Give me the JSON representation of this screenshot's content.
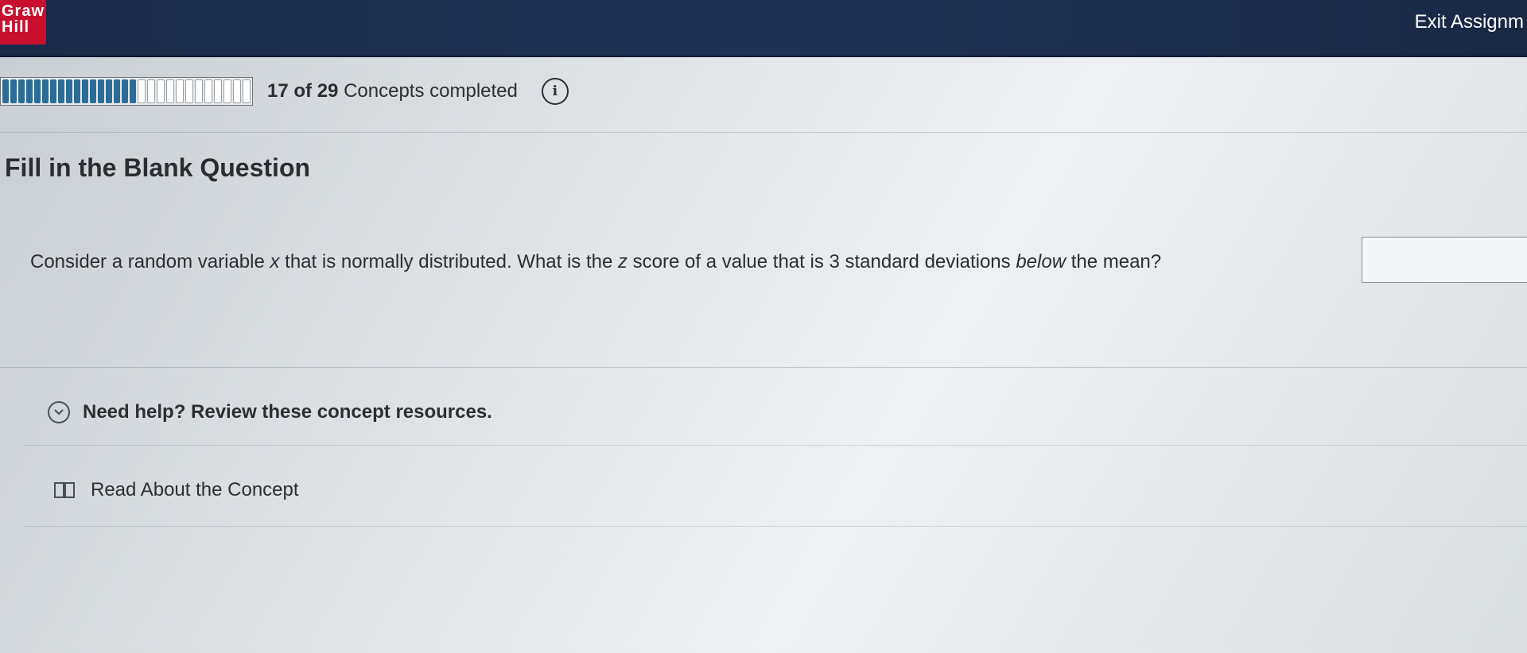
{
  "header": {
    "logo_line1": "Graw",
    "logo_line2": "Hill",
    "exit_label": "Exit Assignm"
  },
  "progress": {
    "completed": "17",
    "of_label": "of",
    "total": "29",
    "label": "Concepts completed",
    "fraction": 0.586,
    "info_icon": "info-icon"
  },
  "question": {
    "type": "Fill in the Blank Question",
    "text_before": "Consider a random variable ",
    "variable_x": "x",
    "text_middle": " that is normally distributed. What is the ",
    "variable_z": "z",
    "text_after_z": " score of a value that is 3 standard deviations ",
    "emphasis": "below",
    "text_end": " the mean?",
    "answer_value": ""
  },
  "help": {
    "toggle_label": "Need help? Review these concept resources.",
    "toggle_icon": "chevron-down-icon",
    "resource_label": "Read About the Concept",
    "resource_icon": "book-icon"
  },
  "colors": {
    "header_bg": "#1f3157",
    "brand_red": "#c8102e",
    "progress_fill": "#2d6c96"
  }
}
